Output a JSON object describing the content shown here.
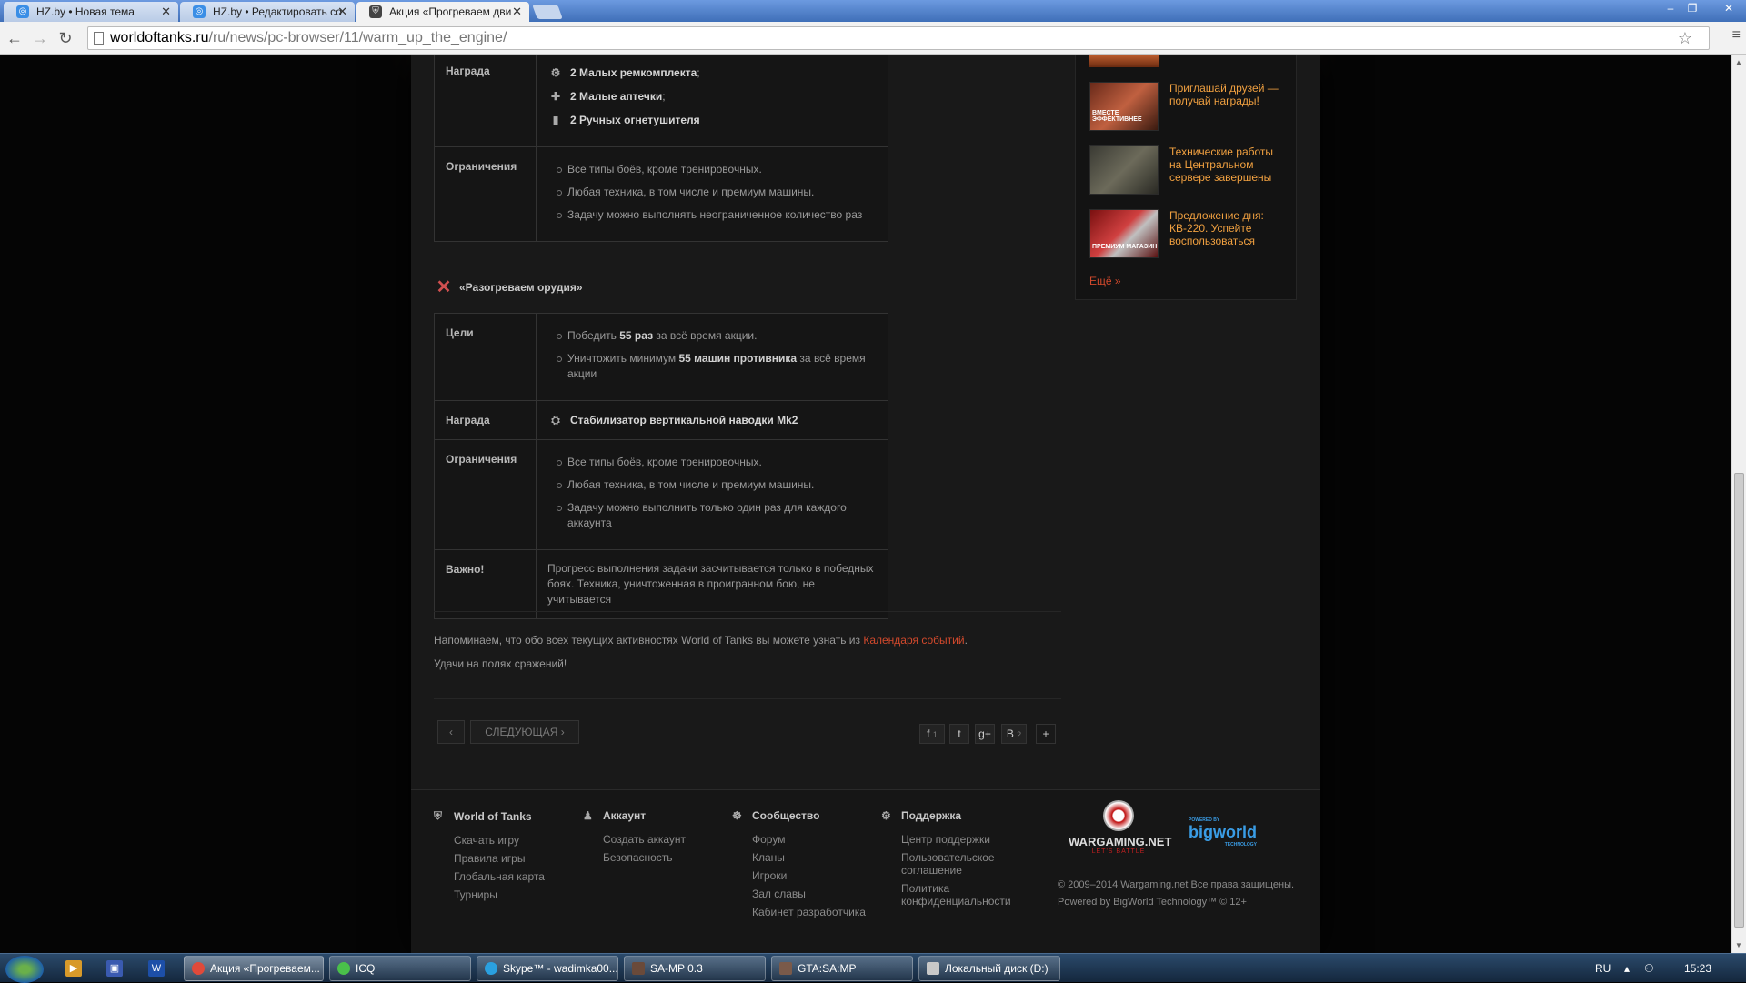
{
  "browser": {
    "tabs": [
      {
        "label": "HZ.by • Новая тема",
        "active": false
      },
      {
        "label": "HZ.by • Редактировать со",
        "active": false
      },
      {
        "label": "Акция «Прогреваем дви",
        "active": true
      }
    ],
    "url_host": "worldoftanks.ru",
    "url_path": "/ru/news/pc-browser/11/warm_up_the_engine/"
  },
  "table1": {
    "reward_label": "Награда",
    "rewards": [
      "2 Малых ремкомплекта",
      "2 Малые аптечки",
      "2 Ручных огнетушителя"
    ],
    "semicolon": ";",
    "limits_label": "Ограничения",
    "limits": [
      "Все типы боёв, кроме тренировочных.",
      "Любая техника, в том числе и премиум машины.",
      "Задачу можно выполнять неограниченное количество раз"
    ]
  },
  "section2": {
    "title": "«Разогреваем орудия»",
    "goals_label": "Цели",
    "goal1_pre": "Победить ",
    "goal1_bold": "55 раз",
    "goal1_post": " за всё время акции.",
    "goal2_pre": "Уничтожить минимум ",
    "goal2_bold": "55 машин противника",
    "goal2_post": " за всё время акции",
    "reward_label": "Награда",
    "reward": "Стабилизатор вертикальной наводки Mk2",
    "limits_label": "Ограничения",
    "limits": [
      "Все типы боёв, кроме тренировочных.",
      "Любая техника, в том числе и премиум машины.",
      "Задачу можно выполнить только один раз для каждого аккаунта"
    ],
    "important_label": "Важно!",
    "important_text": "Прогресс выполнения задачи засчитывается только в победных боях. Техника, уничтоженная в проигранном бою, не учитывается"
  },
  "article": {
    "reminder_pre": "Напоминаем, что обо всех текущих активностях World of Tanks вы можете узнать из ",
    "reminder_link": "Календаря событий",
    "reminder_post": ".",
    "goodluck": "Удачи на полях сражений!"
  },
  "pager": {
    "prev": "‹",
    "next": "СЛЕДУЮЩАЯ ›"
  },
  "share": [
    {
      "icon": "f",
      "count": "1"
    },
    {
      "icon": "t",
      "count": ""
    },
    {
      "icon": "g+",
      "count": ""
    },
    {
      "icon": "B",
      "count": "2"
    },
    {
      "icon": "+",
      "count": ""
    }
  ],
  "sidebar": {
    "news": [
      {
        "title": "Приглашай друзей — получай награды!",
        "thumb_caption": "ВМЕСТЕ ЭФФЕКТИВНЕЕ"
      },
      {
        "title": "Технические работы на Центральном сервере завершены",
        "thumb_caption": ""
      },
      {
        "title": "Предложение дня: КВ-220. Успейте воспользоваться",
        "thumb_caption": "ПРЕМИУМ МАГАЗИН"
      }
    ],
    "more": "Ещё »"
  },
  "footer": {
    "cols": [
      {
        "head": "World of Tanks",
        "links": [
          "Скачать игру",
          "Правила игры",
          "Глобальная карта",
          "Турниры"
        ]
      },
      {
        "head": "Аккаунт",
        "links": [
          "Создать аккаунт",
          "Безопасность"
        ]
      },
      {
        "head": "Сообщество",
        "links": [
          "Форум",
          "Кланы",
          "Игроки",
          "Зал славы",
          "Кабинет разработчика"
        ]
      },
      {
        "head": "Поддержка",
        "links": [
          "Центр поддержки",
          "Пользовательское соглашение",
          "Политика конфиденциальности"
        ]
      }
    ],
    "wg_name": "WARGAMING.NET",
    "wg_slogan": "LET'S BATTLE",
    "bw_small": "POWERED BY",
    "bw_name": "bigworld",
    "bw_sub": "TECHNOLOGY",
    "copyright": "© 2009–2014 Wargaming.net Все права защищены.",
    "powered": "Powered by BigWorld Technology™ © 12+"
  },
  "taskbar": {
    "tasks": [
      "Акция «Прогреваем...",
      "ICQ",
      "Skype™ - wadimka00...",
      "SA-MP 0.3",
      "GTA:SA:MP",
      "Локальный диск (D:)"
    ],
    "lang": "RU",
    "clock": "15:23"
  }
}
